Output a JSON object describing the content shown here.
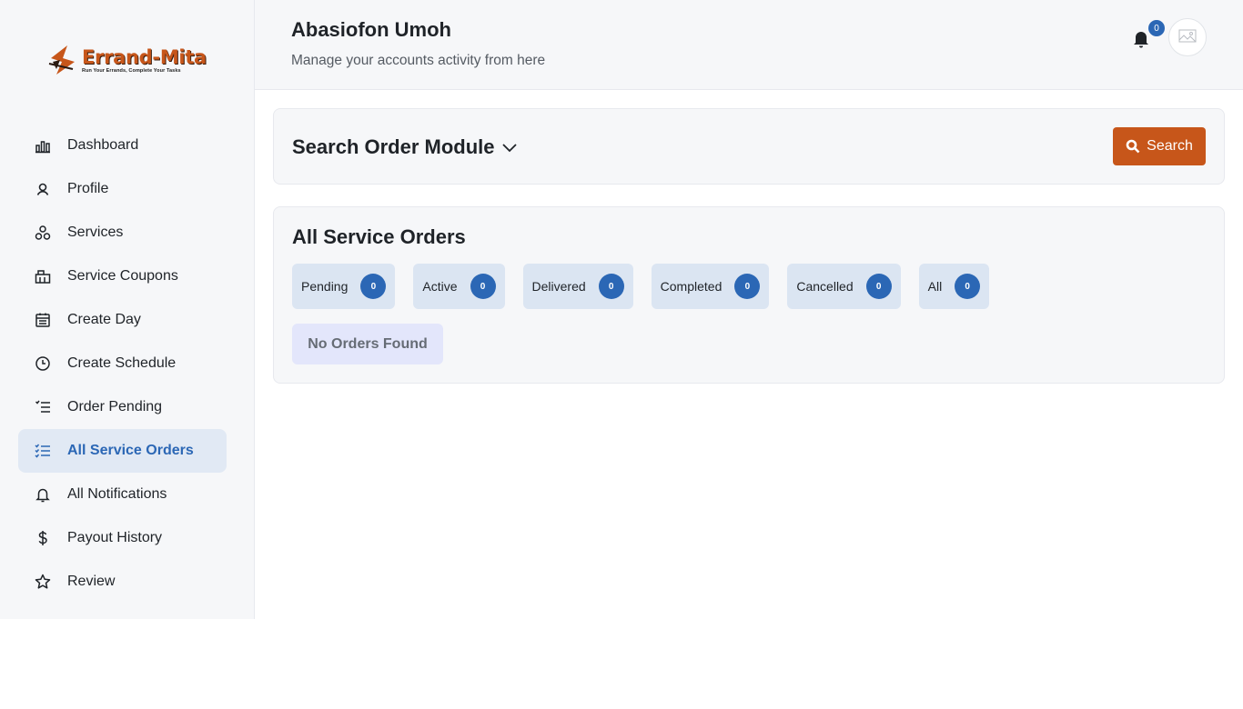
{
  "brand": {
    "name": "Errand-Mita",
    "tagline": "Run Your Errands, Complete Your Tasks",
    "color": "#c7561a"
  },
  "sidebar": {
    "items": [
      {
        "label": "Dashboard",
        "icon": "bar-chart-icon"
      },
      {
        "label": "Profile",
        "icon": "user-icon"
      },
      {
        "label": "Services",
        "icon": "services-icon"
      },
      {
        "label": "Service Coupons",
        "icon": "coupon-icon"
      },
      {
        "label": "Create Day",
        "icon": "calendar-icon"
      },
      {
        "label": "Create Schedule",
        "icon": "clock-icon"
      },
      {
        "label": "Order Pending",
        "icon": "checklist-icon"
      },
      {
        "label": "All Service Orders",
        "icon": "list-check-icon",
        "active": true
      },
      {
        "label": "All Notifications",
        "icon": "bell-icon"
      },
      {
        "label": "Payout History",
        "icon": "dollar-icon"
      },
      {
        "label": "Review",
        "icon": "star-icon"
      }
    ]
  },
  "header": {
    "user_name": "Abasiofon Umoh",
    "subtitle": "Manage your accounts activity from here",
    "notification_count": "0",
    "avatar_alt": "No image"
  },
  "search": {
    "title": "Search Order Module",
    "button_label": "Search"
  },
  "orders": {
    "title": "All Service Orders",
    "tabs": [
      {
        "label": "Pending",
        "count": "0"
      },
      {
        "label": "Active",
        "count": "0"
      },
      {
        "label": "Delivered",
        "count": "0"
      },
      {
        "label": "Completed",
        "count": "0"
      },
      {
        "label": "Cancelled",
        "count": "0"
      },
      {
        "label": "All",
        "count": "0"
      }
    ],
    "empty_message": "No Orders Found"
  },
  "colors": {
    "accent": "#2b67b5",
    "primary_button": "#c7561a",
    "active_nav_bg": "#e1e9f4"
  }
}
